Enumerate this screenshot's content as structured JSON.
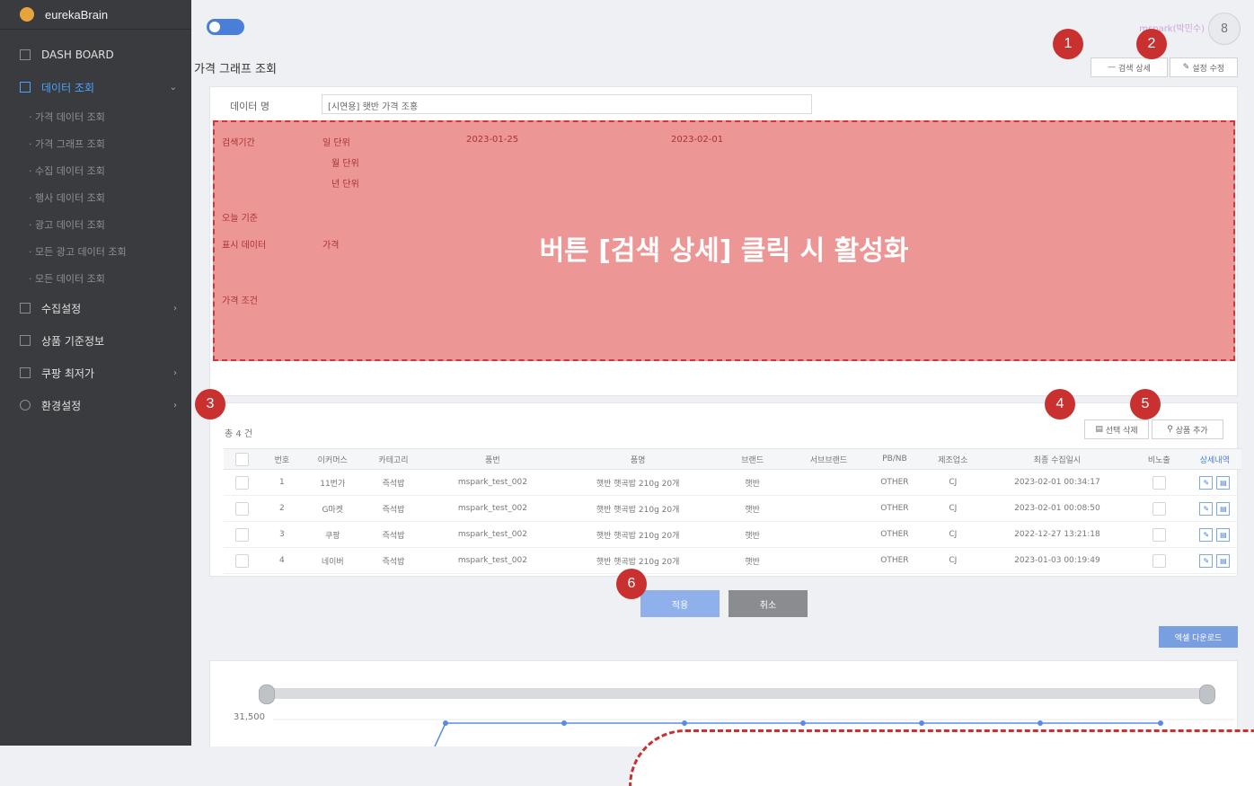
{
  "sidebar": {
    "brand": "eurekaBrain",
    "items": [
      {
        "label": "DASH BOARD"
      },
      {
        "label": "데이터 조회"
      },
      {
        "label": "수집설정"
      },
      {
        "label": "상품 기준정보"
      },
      {
        "label": "쿠팡 최저가"
      },
      {
        "label": "환경설정"
      }
    ],
    "subitems": [
      "· 가격 데이터 조회",
      "· 가격 그래프 조회",
      "· 수집 데이터 조회",
      "· 행사 데이터 조회",
      "· 광고 데이터 조회",
      "· 모든 광고 데이터 조회",
      "· 모든 데이터 조회"
    ]
  },
  "header": {
    "username": "mspark(박민수)",
    "user_icon": "lock-icon",
    "title": "가격 그래프 조회",
    "search_detail": "검색 상세",
    "edit_settings": "설정 수정"
  },
  "form": {
    "data_name_label": "데이터 명",
    "data_name_value": "[시연용] 햇반 가격 조홍"
  },
  "overlay": {
    "text": "버튼 [검색 상세] 클릭 시 활성화",
    "labels": {
      "period": "검색기간",
      "today": "오늘 기준",
      "display": "표시 데이터",
      "price_cond": "가격 조건",
      "day": "일 단위",
      "month": "월 단위",
      "year": "년 단위",
      "date_from": "2023-01-25",
      "date_to": "2023-02-01",
      "price": "가격"
    }
  },
  "list": {
    "count": "총 4 건",
    "delete_selected": "선택 삭제",
    "add_product": "상품 추가",
    "columns": [
      "번호",
      "이커머스",
      "카테고리",
      "품번",
      "품명",
      "브랜드",
      "서브브랜드",
      "PB/NB",
      "제조업소",
      "최종 수집일시",
      "비노출",
      "상세내역"
    ],
    "rows": [
      {
        "no": "1",
        "mall": "11번가",
        "category": "즉석밥",
        "code": "mspark_test_002",
        "name": "햇반 햇곡밥 210g 20개",
        "brand": "햇반",
        "sub": "",
        "pbnb": "OTHER",
        "maker": "CJ",
        "date": "2023-02-01 00:34:17"
      },
      {
        "no": "2",
        "mall": "G마켓",
        "category": "즉석밥",
        "code": "mspark_test_002",
        "name": "햇반 햇곡밥 210g 20개",
        "brand": "햇반",
        "sub": "",
        "pbnb": "OTHER",
        "maker": "CJ",
        "date": "2023-02-01 00:08:50"
      },
      {
        "no": "3",
        "mall": "쿠팡",
        "category": "즉석밥",
        "code": "mspark_test_002",
        "name": "햇반 햇곡밥 210g 20개",
        "brand": "햇반",
        "sub": "",
        "pbnb": "OTHER",
        "maker": "CJ",
        "date": "2022-12-27 13:21:18"
      },
      {
        "no": "4",
        "mall": "네이버",
        "category": "즉석밥",
        "code": "mspark_test_002",
        "name": "햇반 햇곡밥 210g 20개",
        "brand": "햇반",
        "sub": "",
        "pbnb": "OTHER",
        "maker": "CJ",
        "date": "2023-01-03 00:19:49"
      }
    ]
  },
  "actions": {
    "apply": "적용",
    "cancel": "취소",
    "excel": "엑셀 다운로드"
  },
  "chart": {
    "ytick": "31,500"
  },
  "markers": [
    "1",
    "2",
    "3",
    "4",
    "5",
    "6"
  ],
  "colors": {
    "accent": "#4a7fd9",
    "marker": "#c8312f",
    "sidebar": "#3a3b3f"
  }
}
